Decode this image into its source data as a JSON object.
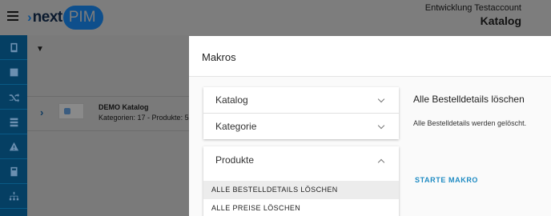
{
  "header": {
    "logo_prefix": "next",
    "logo_suffix": "PIM",
    "account_name": "Entwicklung Testaccount",
    "page_title": "Katalog"
  },
  "sidebar": {
    "items": [
      {
        "icon": "book-icon"
      },
      {
        "icon": "list-icon"
      },
      {
        "icon": "shuffle-icon"
      },
      {
        "icon": "server-icon"
      },
      {
        "icon": "warning-icon"
      },
      {
        "icon": "calculator-icon"
      },
      {
        "icon": "hierarchy-icon"
      }
    ]
  },
  "catalog_row": {
    "title": "DEMO Katalog",
    "subtitle": "Kategorien: 17 - Produkte: 5"
  },
  "modal": {
    "title": "Makros",
    "sections": [
      {
        "label": "Katalog",
        "expanded": false
      },
      {
        "label": "Kategorie",
        "expanded": false
      },
      {
        "label": "Produkte",
        "expanded": true
      }
    ],
    "macros": [
      {
        "label": "ALLE BESTELLDETAILS LÖSCHEN",
        "selected": true
      },
      {
        "label": "ALLE PREISE LÖSCHEN",
        "selected": false
      }
    ],
    "detail": {
      "title": "Alle Bestelldetails löschen",
      "description": "Alle Bestelldetails werden gelöscht.",
      "button_label": "STARTE MAKRO"
    }
  },
  "colors": {
    "sidebar_bg": "#053f63",
    "brand_blue": "#0e4f8c",
    "accent": "#1e8bc3",
    "overlay": "#7a7a7a"
  }
}
